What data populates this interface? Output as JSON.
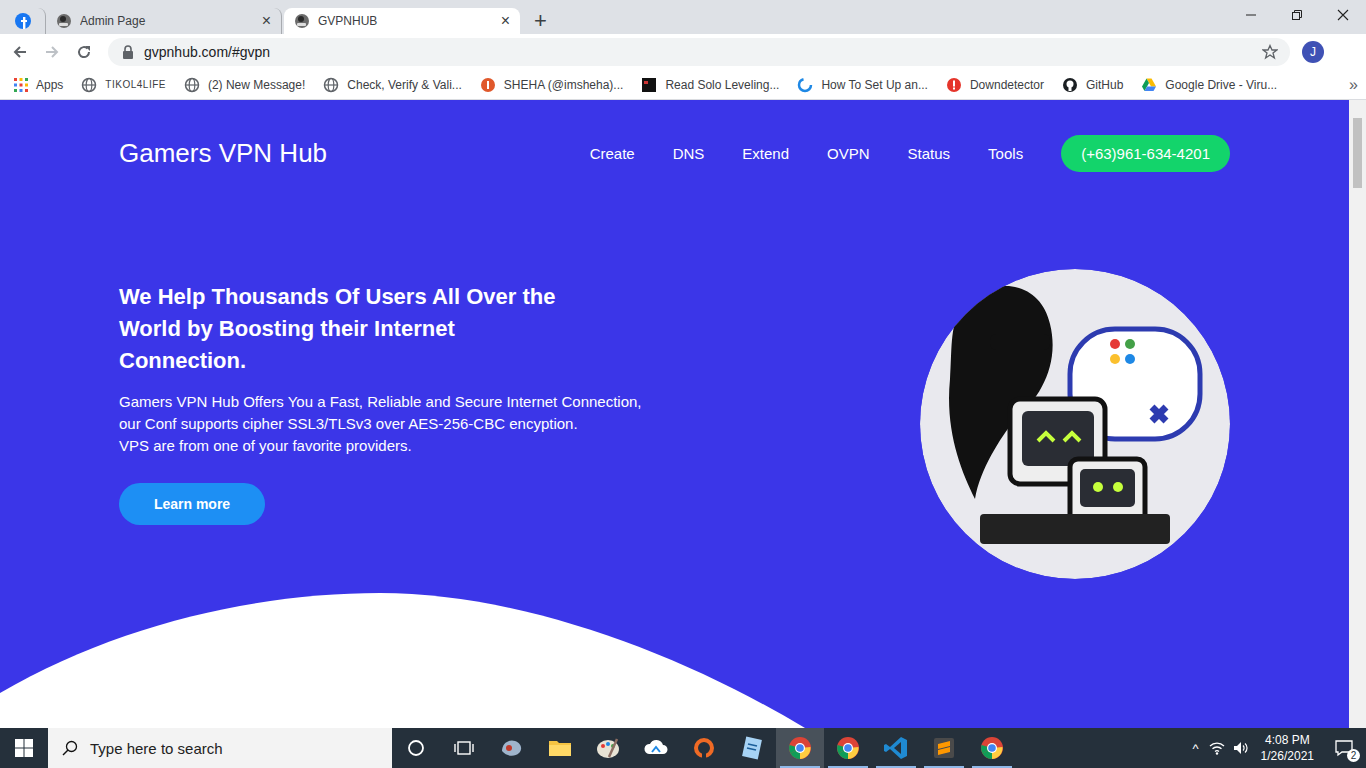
{
  "browser": {
    "tabs": [
      {
        "label": "",
        "kind": "pinned",
        "selected": false
      },
      {
        "label": "Admin Page",
        "kind": "normal",
        "selected": false
      },
      {
        "label": "GVPNHUB",
        "kind": "normal",
        "selected": true
      }
    ],
    "tab_close": "×",
    "new_tab": "+",
    "address": "gvpnhub.com/#gvpn",
    "profile": "J",
    "bookmarks": [
      {
        "label": "Apps",
        "kind": "apps"
      },
      {
        "label": "TIKOL4LIFE",
        "kind": "globe"
      },
      {
        "label": "(2) New Message!",
        "kind": "globe"
      },
      {
        "label": "Check, Verify & Vali...",
        "kind": "globe"
      },
      {
        "label": "SHEHA (@imsheha)...",
        "kind": "red"
      },
      {
        "label": "Read Solo Leveling...",
        "kind": "film"
      },
      {
        "label": "How To Set Up an...",
        "kind": "cloud"
      },
      {
        "label": "Downdetector",
        "kind": "alert"
      },
      {
        "label": "GitHub",
        "kind": "github"
      },
      {
        "label": "Google Drive - Viru...",
        "kind": "drive"
      }
    ],
    "bookmarks_more": "»"
  },
  "site": {
    "logo": "Gamers VPN Hub",
    "nav": [
      "Create",
      "DNS",
      "Extend",
      "OVPN",
      "Status",
      "Tools"
    ],
    "phone": "(+63)961-634-4201",
    "heading": "We Help Thousands Of Users All Over the World by Boosting their Internet Connection.",
    "paragraph": [
      "Gamers VPN Hub Offers You a Fast, Reliable and Secure Internet Connection,",
      "our Conf supports cipher SSL3/TLSv3 over AES-256-CBC encyption.",
      "VPS are from one of your favorite providers."
    ],
    "button": "Learn more"
  },
  "taskbar": {
    "search_placeholder": "Type here to search",
    "apps": [
      {
        "kind": "app",
        "running": false,
        "active": false
      },
      {
        "kind": "folder",
        "running": false,
        "active": false
      },
      {
        "kind": "paint",
        "running": false,
        "active": false
      },
      {
        "kind": "cloud",
        "running": false,
        "active": false
      },
      {
        "kind": "ring",
        "running": false,
        "active": false
      },
      {
        "kind": "notes",
        "running": false,
        "active": false
      },
      {
        "kind": "chrome",
        "running": true,
        "active": true
      },
      {
        "kind": "chrome",
        "running": true,
        "active": false
      },
      {
        "kind": "code",
        "running": true,
        "active": false
      },
      {
        "kind": "sublime",
        "running": true,
        "active": false
      },
      {
        "kind": "chrome",
        "running": true,
        "active": false
      }
    ],
    "chevron": "^",
    "time": "4:08 PM",
    "date": "1/26/2021",
    "notifications": "2"
  }
}
